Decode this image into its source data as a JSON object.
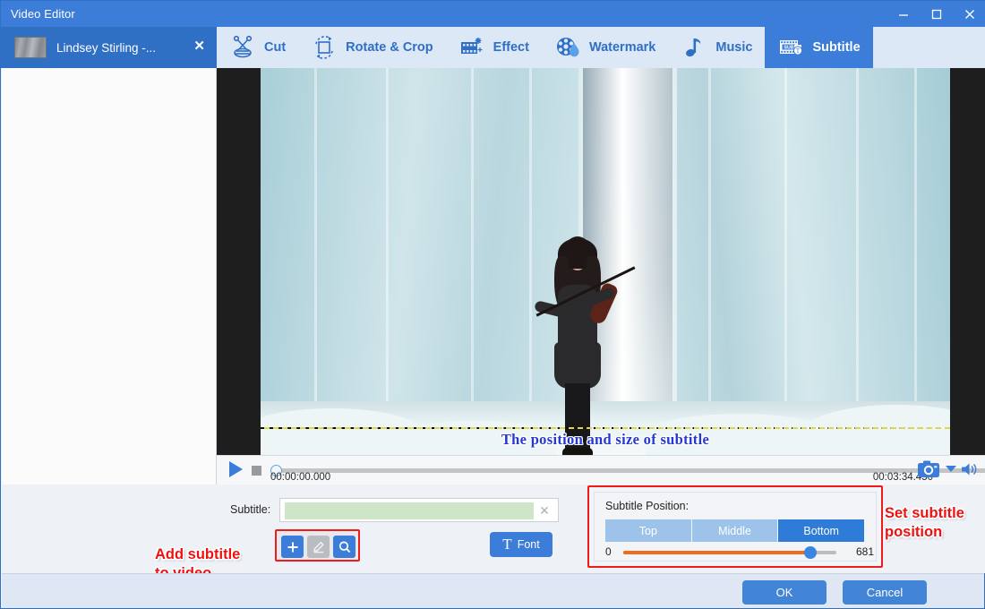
{
  "window": {
    "title": "Video Editor",
    "controls": [
      {
        "name": "minimize-button",
        "glyph": "minimize"
      },
      {
        "name": "maximize-button",
        "glyph": "maximize"
      },
      {
        "name": "close-button",
        "glyph": "close"
      }
    ]
  },
  "file_tab": {
    "name": "Lindsey Stirling -...",
    "close_label": "✕"
  },
  "tabs": [
    {
      "label": "Cut",
      "icon": "scissors-icon",
      "active": false
    },
    {
      "label": "Rotate & Crop",
      "icon": "rotate-crop-icon",
      "active": false
    },
    {
      "label": "Effect",
      "icon": "effect-film-icon",
      "active": false
    },
    {
      "label": "Watermark",
      "icon": "watermark-icon",
      "active": false
    },
    {
      "label": "Music",
      "icon": "music-note-icon",
      "active": false
    },
    {
      "label": "Subtitle",
      "icon": "subtitle-icon",
      "active": true
    }
  ],
  "preview": {
    "subtitle_overlay_text": "The position and size of subtitle",
    "subtitle_overlay_color": "#2438d6",
    "guide_line_color": "#d9d94a"
  },
  "transport": {
    "play_label": "play-button",
    "stop_label": "stop-button",
    "time_start": "00:00:00.000",
    "time_end": "00:03:34.450",
    "snapshot_label": "snapshot-button",
    "volume_label": "volume-button"
  },
  "subtitle_panel": {
    "label": "Subtitle:",
    "input_value": "",
    "input_placeholder": "",
    "clear_label": "✕",
    "buttons": [
      {
        "name": "add-subtitle-button",
        "glyph": "+",
        "state": "enabled"
      },
      {
        "name": "edit-subtitle-button",
        "glyph": "pencil",
        "state": "disabled"
      },
      {
        "name": "search-subtitle-button",
        "glyph": "magnifier",
        "state": "enabled"
      }
    ],
    "font_button": {
      "label": "Font",
      "glyph": "T"
    }
  },
  "position_panel": {
    "title": "Subtitle Position:",
    "options": [
      "Top",
      "Middle",
      "Bottom"
    ],
    "selected": "Bottom",
    "slider": {
      "min": "0",
      "max": "681",
      "value": 681,
      "percent": 89
    }
  },
  "annotations": [
    {
      "name": "annotation-add-subtitle",
      "text": "Add subtitle\nto video"
    },
    {
      "name": "annotation-set-position",
      "text": "Set subtitle\nposition"
    }
  ],
  "footer": {
    "ok_label": "OK",
    "cancel_label": "Cancel"
  },
  "colors": {
    "title_bar": "#3b7dd8",
    "accent_blue": "#2f6fc4",
    "tab_strip": "#dde8f7",
    "annotation_red": "#ee1111",
    "slider_orange": "#ef6c1a",
    "input_green": "#cfe5c8"
  }
}
